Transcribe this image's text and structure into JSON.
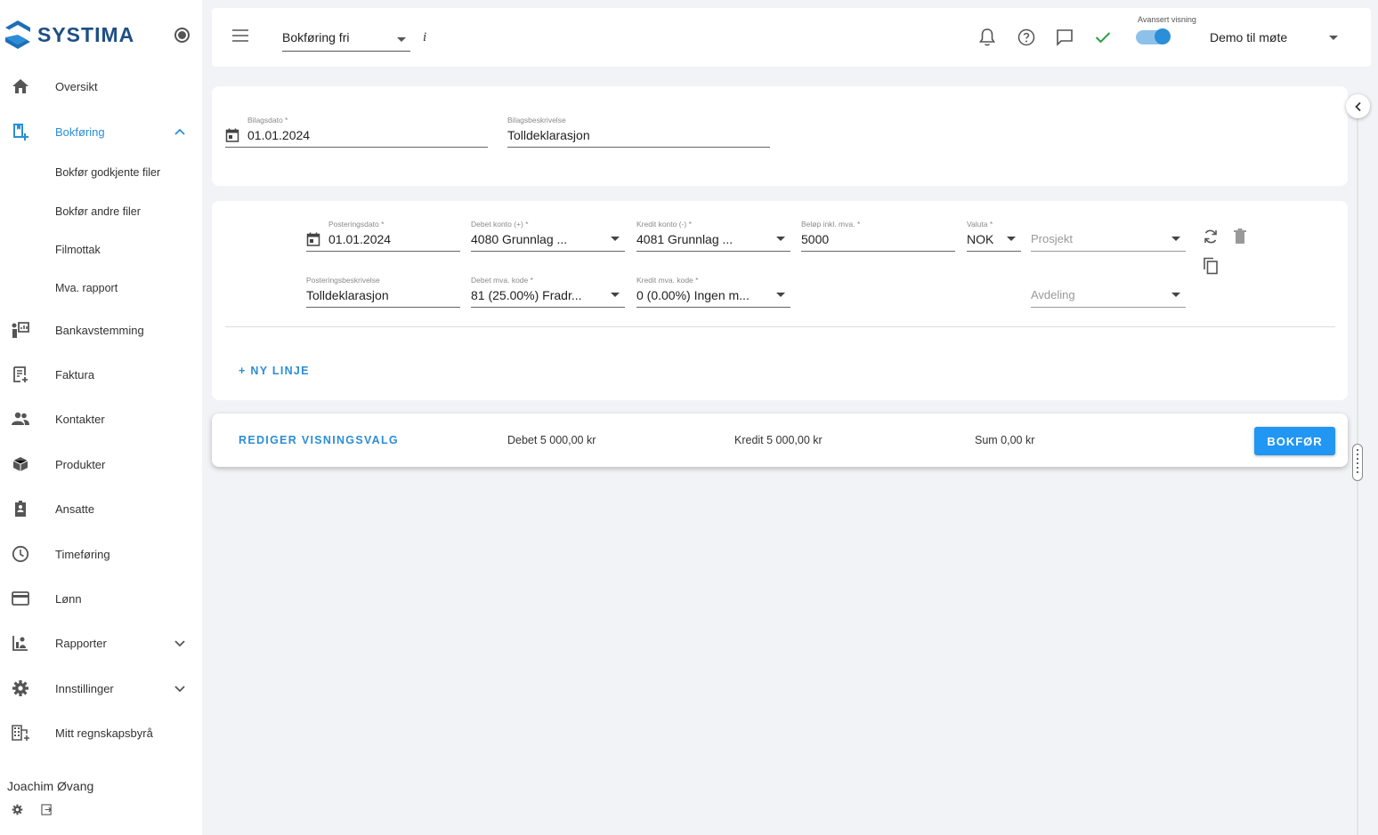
{
  "app": {
    "logo_text": "SYSTIMA"
  },
  "sidebar": {
    "items": [
      {
        "label": "Oversikt",
        "icon": "home-icon"
      },
      {
        "label": "Bokføring",
        "icon": "bookkeeping-icon",
        "active": true,
        "expanded": true,
        "sub": [
          "Bokfør godkjente filer",
          "Bokfør andre filer",
          "Filmottak",
          "Mva. rapport"
        ]
      },
      {
        "label": "Bankavstemming",
        "icon": "bank-reconciliation-icon"
      },
      {
        "label": "Faktura",
        "icon": "invoice-icon"
      },
      {
        "label": "Kontakter",
        "icon": "contacts-icon"
      },
      {
        "label": "Produkter",
        "icon": "products-icon"
      },
      {
        "label": "Ansatte",
        "icon": "employees-icon"
      },
      {
        "label": "Timeføring",
        "icon": "clock-icon"
      },
      {
        "label": "Lønn",
        "icon": "payroll-card-icon"
      },
      {
        "label": "Rapporter",
        "icon": "reports-icon"
      },
      {
        "label": "Innstillinger",
        "icon": "gear-icon"
      },
      {
        "label": "Mitt regnskapsbyrå",
        "icon": "accounting-firm-icon"
      }
    ],
    "user_name": "Joachim Øvang"
  },
  "topbar": {
    "page_select": "Bokføring fri",
    "info": "i",
    "toggle_label": "Avansert visning",
    "toggle_on": true,
    "company": "Demo til møte"
  },
  "voucher": {
    "date_label": "Bilagsdato *",
    "date_value": "01.01.2024",
    "desc_label": "Bilagsbeskrivelse",
    "desc_value": "Tolldeklarasjon"
  },
  "line": {
    "post_date_label": "Posteringsdato *",
    "post_date_value": "01.01.2024",
    "debit_label": "Debet konto (+) *",
    "debit_value": "4080 Grunnlag ...",
    "credit_label": "Kredit konto (-) *",
    "credit_value": "4081 Grunnlag ...",
    "amount_label": "Beløp inkl. mva. *",
    "amount_value": "5000",
    "currency_label": "Valuta *",
    "currency_value": "NOK",
    "project_placeholder": "Prosjekt",
    "post_desc_label": "Posteringsbeskrivelse",
    "post_desc_value": "Tolldeklarasjon",
    "debit_vat_label": "Debet mva. kode *",
    "debit_vat_value": "81 (25.00%) Fradr...",
    "credit_vat_label": "Kredit mva. kode *",
    "credit_vat_value": "0 (0.00%) Ingen m...",
    "department_placeholder": "Avdeling"
  },
  "actions": {
    "new_line": "+ NY LINJE",
    "edit_view": "REDIGER VISNINGSVALG",
    "debit_sum": "Debet 5 000,00 kr",
    "credit_sum": "Kredit 5 000,00 kr",
    "sum": "Sum 0,00 kr",
    "post_button": "BOKFØR"
  },
  "colors": {
    "accent": "#2b8ed8",
    "button": "#2196f3",
    "brand": "#1e4f83",
    "check": "#2e9e44"
  }
}
